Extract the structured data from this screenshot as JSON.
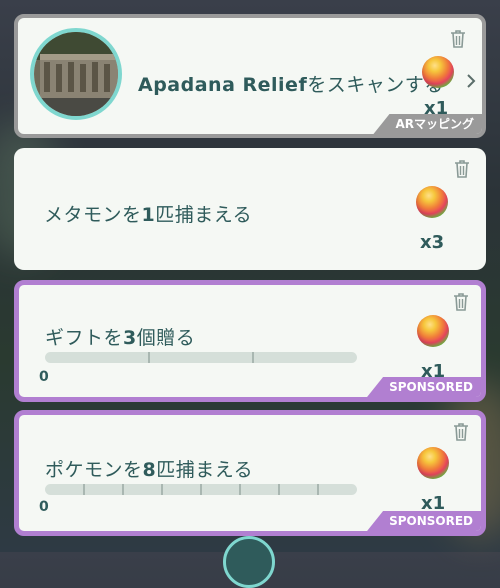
{
  "cards": [
    {
      "title_name": "Apadana Relief",
      "title_suffix": "をスキャンする",
      "count": "x1",
      "tag": "ARマッピング"
    },
    {
      "title_pre": "メタモンを",
      "title_num": "1",
      "title_post": "匹捕まえる",
      "count": "x3"
    },
    {
      "title_pre": "ギフトを",
      "title_num": "3",
      "title_post": "個贈る",
      "count": "x1",
      "progress_value": 0,
      "progress_total": 3,
      "progress_label": "0",
      "tag": "SPONSORED"
    },
    {
      "title_pre": "ポケモンを",
      "title_num": "8",
      "title_post": "匹捕まえる",
      "count": "x1",
      "progress_value": 0,
      "progress_total": 8,
      "progress_label": "0",
      "tag": "SPONSORED"
    }
  ],
  "icons": {
    "trash": "trash-icon",
    "reward": "rare-candy-icon",
    "chevron": "chevron-right-icon"
  },
  "colors": {
    "text": "#2f5b5b",
    "sponsored": "#b17fd1",
    "ar_border": "#9a9a9a",
    "ring": "#7fd7cf"
  }
}
